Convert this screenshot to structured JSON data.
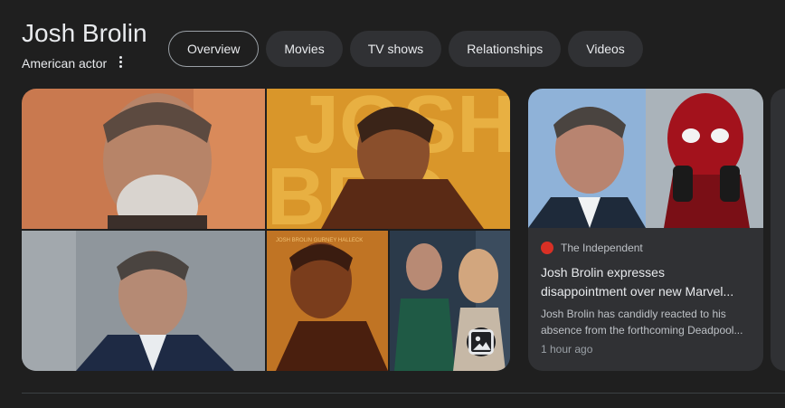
{
  "entity": {
    "name": "Josh Brolin",
    "description": "American actor"
  },
  "icons": {
    "more": "more-vert-icon",
    "image": "image-icon",
    "source": "independent-logo-icon"
  },
  "tabs": [
    {
      "label": "Overview",
      "active": true
    },
    {
      "label": "Movies",
      "active": false
    },
    {
      "label": "TV shows",
      "active": false
    },
    {
      "label": "Relationships",
      "active": false
    },
    {
      "label": "Videos",
      "active": false
    }
  ],
  "news": {
    "source": "The Independent",
    "title": "Josh Brolin expresses disappointment over new Marvel...",
    "snippet": "Josh Brolin has candidly reacted to his absence from the forthcoming Deadpool...",
    "time": "1 hour ago"
  },
  "colors": {
    "background": "#1f1f1f",
    "chip": "#303134",
    "card": "#303134",
    "accent_red": "#d93025"
  }
}
